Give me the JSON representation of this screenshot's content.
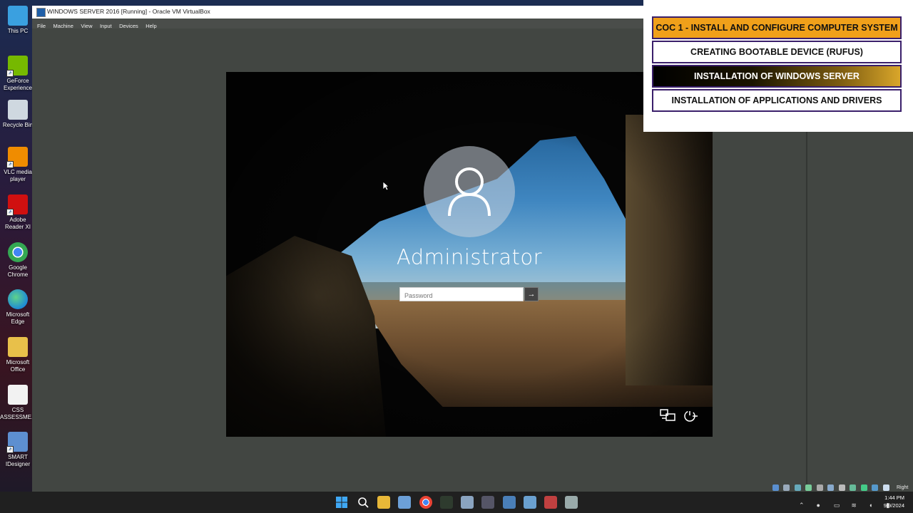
{
  "desktop": {
    "icons": [
      {
        "label": "This PC",
        "icon": "computer-icon",
        "color": "#3aa0e0"
      },
      {
        "label": "GeForce Experience",
        "icon": "nvidia-icon",
        "color": "#76b900"
      },
      {
        "label": "Recycle Bin",
        "icon": "recycle-bin-icon",
        "color": "#cfd8e0"
      },
      {
        "label": "VLC media player",
        "icon": "vlc-icon",
        "color": "#f08c00"
      },
      {
        "label": "Adobe Reader XI",
        "icon": "adobe-reader-icon",
        "color": "#d01010"
      },
      {
        "label": "Google Chrome",
        "icon": "chrome-icon",
        "color": "#34a853"
      },
      {
        "label": "Microsoft Edge",
        "icon": "edge-icon",
        "color": "#1e8ad6"
      },
      {
        "label": "Microsoft Office",
        "icon": "folder-icon",
        "color": "#e8c04a"
      },
      {
        "label": "CSS ASSESSME...",
        "icon": "document-icon",
        "color": "#f2f2f2"
      },
      {
        "label": "SMART IDesigner",
        "icon": "smart-designer-icon",
        "color": "#5d8fd0"
      }
    ]
  },
  "vbox": {
    "title": "WINDOWS SERVER 2016 [Running] - Oracle VM VirtualBox",
    "menu": [
      "File",
      "Machine",
      "View",
      "Input",
      "Devices",
      "Help"
    ],
    "status_label": "Right Ctrl"
  },
  "vm": {
    "username": "Administrator",
    "password_placeholder": "Password",
    "submit_glyph": "→"
  },
  "overlay": {
    "items": [
      "COC 1 - INSTALL AND CONFIGURE COMPUTER SYSTEM",
      "CREATING BOOTABLE DEVICE (RUFUS)",
      "INSTALLATION OF WINDOWS SERVER",
      "INSTALLATION OF APPLICATIONS AND DRIVERS"
    ]
  },
  "taskbar": {
    "time": "1:44 PM",
    "date": "9/9/2024"
  }
}
